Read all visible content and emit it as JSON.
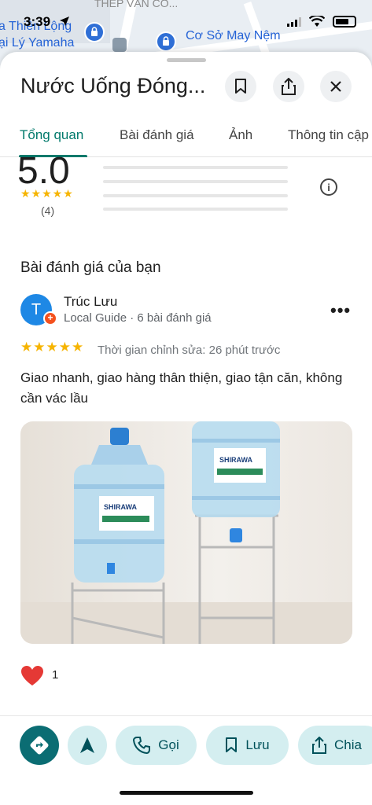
{
  "status_bar": {
    "time": "3:39"
  },
  "map": {
    "labels": [
      "a Thiên Lộng",
      "ại Lý Yamaha",
      "Cơ Sở May Nệm",
      "THÉP VĂN CÔ..."
    ]
  },
  "place": {
    "title": "Nước Uống Đóng..."
  },
  "tabs": [
    {
      "label": "Tổng quan",
      "active": true
    },
    {
      "label": "Bài đánh giá",
      "active": false
    },
    {
      "label": "Ảnh",
      "active": false
    },
    {
      "label": "Thông tin cập",
      "active": false
    }
  ],
  "rating": {
    "score": "5.0",
    "stars": "★★★★★",
    "count": "(4)"
  },
  "your_review": {
    "section_title": "Bài đánh giá của bạn",
    "avatar_initial": "T",
    "reviewer_name": "Trúc Lưu",
    "reviewer_meta": "Local Guide · 6 bài đánh giá",
    "stars": "★★★★★",
    "edited": "Thời gian chỉnh sửa: 26 phút trước",
    "text": "Giao nhanh, giao hàng thân thiện, giao tận căn, không cần vác lầu",
    "photo_brand": "SHIRAWA",
    "like_count": "1"
  },
  "actions": {
    "call_label": "Gọi",
    "save_label": "Lưu",
    "share_label": "Chia"
  },
  "colors": {
    "accent": "#00796b",
    "action_bg": "#d4eef0",
    "primary_action": "#0b6d73",
    "star": "#f6b400",
    "heart": "#e53935"
  }
}
